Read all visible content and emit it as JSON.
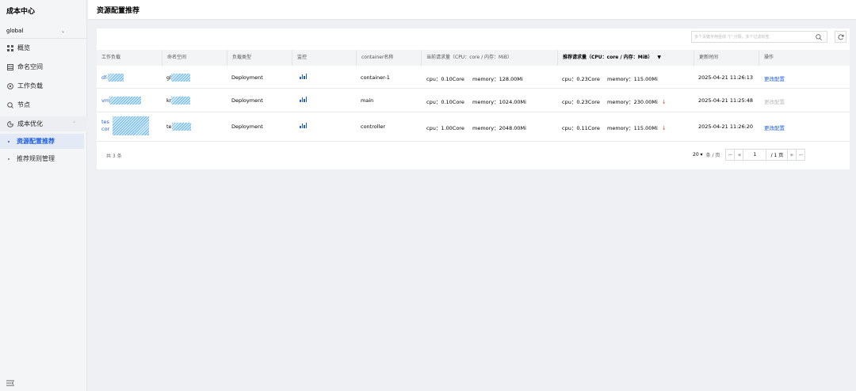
{
  "app": {
    "title": "成本中心"
  },
  "cluster_select": {
    "value": "global"
  },
  "nav": {
    "overview": "概览",
    "namespace": "命名空间",
    "workload": "工作负载",
    "node": "节点",
    "cost_opt": "成本优化",
    "resource_rec": "资源配置推荐",
    "rule_mgmt": "推荐规则管理"
  },
  "page": {
    "title": "资源配置推荐"
  },
  "search": {
    "placeholder": "多个关键字用竖线 \"|\" 分隔，多个过滤标签"
  },
  "table": {
    "headers": [
      "工作负载",
      "命名空间",
      "负载类型",
      "监控",
      "container名称",
      "当前请求量（CPU：core / 内存：MiB）",
      "推荐请求量（CPU：core / 内存：MiB）",
      "更新时间",
      "操作"
    ],
    "rows": [
      {
        "workload": "df-",
        "namespace": "gl",
        "type": "Deployment",
        "container": "container-1",
        "cur_cpu": "cpu：0.10Core",
        "cur_mem": "memory：128.00Mi",
        "rec_cpu": "cpu：0.23Core",
        "rec_mem": "memory：115.00Mi",
        "rec_down": false,
        "time": "2025-04-21 11:26:13",
        "action": "更改配置",
        "action_enabled": true
      },
      {
        "workload": "vm",
        "namespace": "kr",
        "type": "Deployment",
        "container": "main",
        "cur_cpu": "cpu：0.10Core",
        "cur_mem": "memory：1024.00Mi",
        "rec_cpu": "cpu：0.23Core",
        "rec_mem": "memory：230.00Mi",
        "rec_down": true,
        "time": "2025-04-21 11:25:48",
        "action": "更改配置",
        "action_enabled": false
      },
      {
        "workload": "tes",
        "workload_line2": "cor",
        "namespace": "te",
        "type": "Deployment",
        "container": "controller",
        "cur_cpu": "cpu：1.00Core",
        "cur_mem": "memory：2048.00Mi",
        "rec_cpu": "cpu：0.11Core",
        "rec_mem": "memory：115.00Mi",
        "rec_down": true,
        "time": "2025-04-21 11:26:20",
        "action": "更改配置",
        "action_enabled": true
      }
    ],
    "down_arrow": "↓",
    "total": "共 3 条"
  },
  "pagination": {
    "page_size": "20 ▾",
    "per_page_label": "条 / 页",
    "first": "⏮",
    "prev": "◀",
    "current": "1",
    "total_pages": "/ 1 页",
    "next": "▶",
    "last": "⏭"
  },
  "colors": {
    "accent": "#1f5fe0",
    "danger": "#e04a3f",
    "mask": "#6fb6e8"
  },
  "icons": [
    "grid-icon",
    "namespace-icon",
    "workload-icon",
    "node-icon",
    "cost-icon",
    "search-icon",
    "refresh-icon",
    "bar-chart-icon",
    "filter-icon",
    "collapse-icon"
  ]
}
